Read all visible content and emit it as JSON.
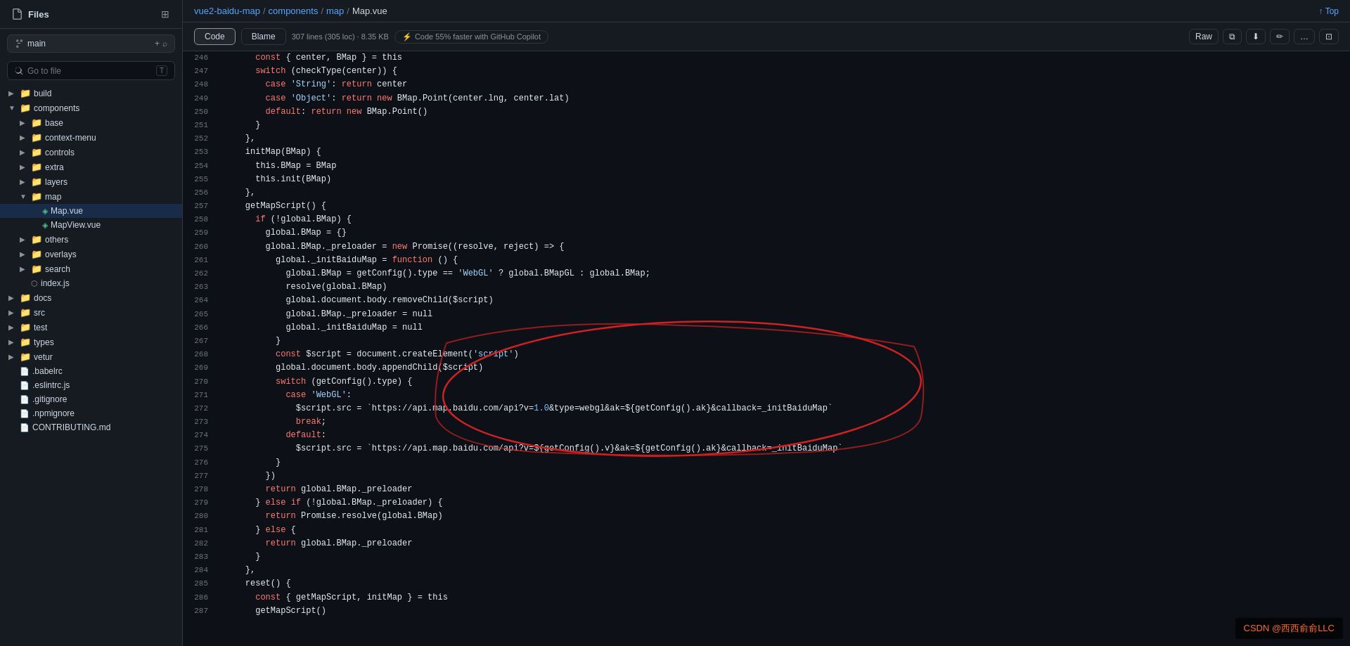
{
  "sidebar": {
    "title": "Files",
    "branch": "main",
    "go_to_file_placeholder": "Go to file",
    "shortcut": "T",
    "tree": [
      {
        "id": "build",
        "type": "folder",
        "name": "build",
        "depth": 0,
        "expanded": false
      },
      {
        "id": "components",
        "type": "folder",
        "name": "components",
        "depth": 0,
        "expanded": true
      },
      {
        "id": "base",
        "type": "folder",
        "name": "base",
        "depth": 1,
        "expanded": false
      },
      {
        "id": "context-menu",
        "type": "folder",
        "name": "context-menu",
        "depth": 1,
        "expanded": false
      },
      {
        "id": "controls",
        "type": "folder",
        "name": "controls",
        "depth": 1,
        "expanded": false
      },
      {
        "id": "extra",
        "type": "folder",
        "name": "extra",
        "depth": 1,
        "expanded": false
      },
      {
        "id": "layers",
        "type": "folder",
        "name": "layers",
        "depth": 1,
        "expanded": false
      },
      {
        "id": "map",
        "type": "folder",
        "name": "map",
        "depth": 1,
        "expanded": true
      },
      {
        "id": "map-vue",
        "type": "file",
        "name": "Map.vue",
        "depth": 2,
        "active": true,
        "vue": true
      },
      {
        "id": "mapview-vue",
        "type": "file",
        "name": "MapView.vue",
        "depth": 2,
        "vue": true
      },
      {
        "id": "others",
        "type": "folder",
        "name": "others",
        "depth": 1,
        "expanded": false
      },
      {
        "id": "overlays",
        "type": "folder",
        "name": "overlays",
        "depth": 1,
        "expanded": false
      },
      {
        "id": "search",
        "type": "folder",
        "name": "search",
        "depth": 1,
        "expanded": false
      },
      {
        "id": "index-js",
        "type": "file",
        "name": "index.js",
        "depth": 1
      },
      {
        "id": "docs",
        "type": "folder",
        "name": "docs",
        "depth": 0,
        "expanded": false
      },
      {
        "id": "src",
        "type": "folder",
        "name": "src",
        "depth": 0,
        "expanded": false
      },
      {
        "id": "test",
        "type": "folder",
        "name": "test",
        "depth": 0,
        "expanded": false
      },
      {
        "id": "types",
        "type": "folder",
        "name": "types",
        "depth": 0,
        "expanded": false
      },
      {
        "id": "vetur",
        "type": "folder",
        "name": "vetur",
        "depth": 0,
        "expanded": false
      },
      {
        "id": "babelrc",
        "type": "file",
        "name": ".babelrc",
        "depth": 0
      },
      {
        "id": "eslintrc",
        "type": "file",
        "name": ".eslintrc.js",
        "depth": 0
      },
      {
        "id": "gitignore",
        "type": "file",
        "name": ".gitignore",
        "depth": 0
      },
      {
        "id": "npmignore",
        "type": "file",
        "name": ".npmignore",
        "depth": 0
      },
      {
        "id": "contributing",
        "type": "file",
        "name": "CONTRIBUTING.md",
        "depth": 0
      }
    ]
  },
  "breadcrumb": {
    "parts": [
      "vue2-baidu-map",
      "components",
      "map",
      "Map.vue"
    ],
    "separators": [
      "/",
      "/",
      "/"
    ]
  },
  "top_link": "↑ Top",
  "file_header": {
    "tab_code": "Code",
    "tab_blame": "Blame",
    "meta": "307 lines (305 loc) · 8.35 KB",
    "copilot": "Code 55% faster with GitHub Copilot",
    "btn_raw": "Raw",
    "btn_copy": "⧉",
    "btn_download": "↓",
    "btn_edit": "✎",
    "btn_more": "…",
    "btn_display": "⊡"
  },
  "code": {
    "lines": [
      {
        "num": 246,
        "content": "      const { center, BMap } = this"
      },
      {
        "num": 247,
        "content": "      switch (checkType(center)) {"
      },
      {
        "num": 248,
        "content": "        case 'String': return center"
      },
      {
        "num": 249,
        "content": "        case 'Object': return new BMap.Point(center.lng, center.lat)"
      },
      {
        "num": 250,
        "content": "        default: return new BMap.Point()"
      },
      {
        "num": 251,
        "content": "      }"
      },
      {
        "num": 252,
        "content": "    },"
      },
      {
        "num": 253,
        "content": "    initMap(BMap) {"
      },
      {
        "num": 254,
        "content": "      this.BMap = BMap"
      },
      {
        "num": 255,
        "content": "      this.init(BMap)"
      },
      {
        "num": 256,
        "content": "    },"
      },
      {
        "num": 257,
        "content": "    getMapScript() {"
      },
      {
        "num": 258,
        "content": "      if (!global.BMap) {"
      },
      {
        "num": 259,
        "content": "        global.BMap = {}"
      },
      {
        "num": 260,
        "content": "        global.BMap._preloader = new Promise((resolve, reject) => {"
      },
      {
        "num": 261,
        "content": "          global._initBaiduMap = function () {"
      },
      {
        "num": 262,
        "content": "            global.BMap = getConfig().type == 'WebGL' ? global.BMapGL : global.BMap;"
      },
      {
        "num": 263,
        "content": "            resolve(global.BMap)"
      },
      {
        "num": 264,
        "content": "            global.document.body.removeChild($script)"
      },
      {
        "num": 265,
        "content": "            global.BMap._preloader = null"
      },
      {
        "num": 266,
        "content": "            global._initBaiduMap = null"
      },
      {
        "num": 267,
        "content": "          }"
      },
      {
        "num": 268,
        "content": "          const $script = document.createElement('script')"
      },
      {
        "num": 269,
        "content": "          global.document.body.appendChild($script)"
      },
      {
        "num": 270,
        "content": "          switch (getConfig().type) {"
      },
      {
        "num": 271,
        "content": "            case 'WebGL':"
      },
      {
        "num": 272,
        "content": "              $script.src = `https://api.map.baidu.com/api?v=1.0&type=webgl&ak=${getConfig().ak}&callback=_initBaiduMap`"
      },
      {
        "num": 273,
        "content": "              break;"
      },
      {
        "num": 274,
        "content": "            default:"
      },
      {
        "num": 275,
        "content": "              $script.src = `https://api.map.baidu.com/api?v=${getConfig().v}&ak=${getConfig().ak}&callback=_initBaiduMap`"
      },
      {
        "num": 276,
        "content": "          }"
      },
      {
        "num": 277,
        "content": "        })"
      },
      {
        "num": 278,
        "content": "        return global.BMap._preloader"
      },
      {
        "num": 279,
        "content": "      } else if (!global.BMap._preloader) {"
      },
      {
        "num": 280,
        "content": "        return Promise.resolve(global.BMap)"
      },
      {
        "num": 281,
        "content": "      } else {"
      },
      {
        "num": 282,
        "content": "        return global.BMap._preloader"
      },
      {
        "num": 283,
        "content": "      }"
      },
      {
        "num": 284,
        "content": "    },"
      },
      {
        "num": 285,
        "content": "    reset() {"
      },
      {
        "num": 286,
        "content": "      const { getMapScript, initMap } = this"
      },
      {
        "num": 287,
        "content": "      getMapScript()"
      }
    ]
  },
  "watermark": {
    "text": "CSDN @西西俞俞LLC"
  }
}
